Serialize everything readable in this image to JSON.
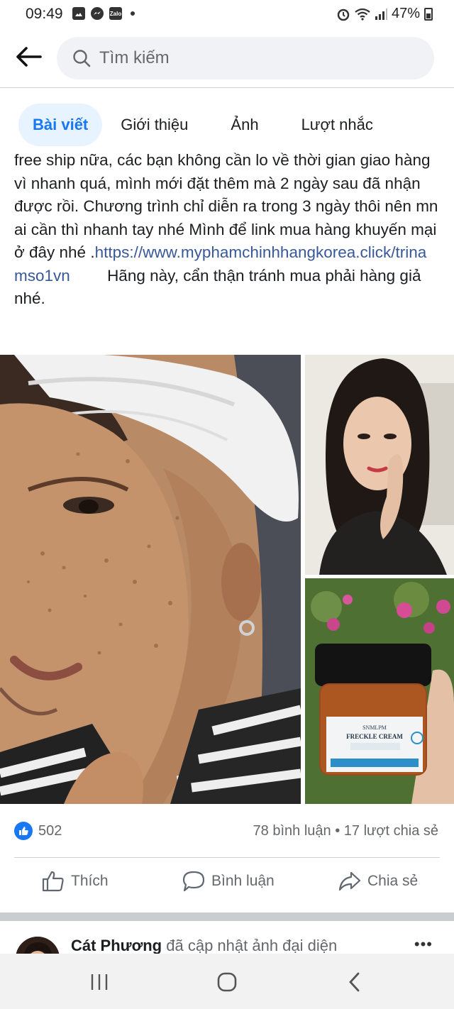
{
  "status_bar": {
    "time": "09:49",
    "battery": "47%",
    "app_icons": [
      "gallery-icon",
      "messenger-icon",
      "zalo-icon"
    ],
    "zalo_label": "Zalo"
  },
  "search": {
    "placeholder": "Tìm kiếm"
  },
  "tabs": [
    {
      "label": "Bài viết",
      "active": true
    },
    {
      "label": "Giới thiệu",
      "active": false
    },
    {
      "label": "Ảnh",
      "active": false
    },
    {
      "label": "Lượt nhắc",
      "active": false
    }
  ],
  "post": {
    "text_top_cut": "free ship nữa, các bạn không cần lo về thời gian",
    "text_main": "giao hàng vì nhanh quá, mình mới đặt thêm mà 2 ngày sau đã nhận được rồi. Chương trình chỉ diễn ra trong 3 ngày thôi nên mn ai cần thì nhanh tay nhé Mình để link mua hàng khuyến mại ở đây nhé .",
    "link": "https://www.myphamchinhhangkorea.click/trinamso1vn",
    "text_after": "Hãng này, cẩn thận tránh mua phải hàng giả nhé.",
    "product_label": {
      "brand": "SNMLPM",
      "name": "FRECKLE CREAM"
    }
  },
  "reactions": {
    "like_count": "502",
    "stats": "78 bình luận • 17 lượt chia sẻ"
  },
  "actions": {
    "like": "Thích",
    "comment": "Bình luận",
    "share": "Chia sẻ"
  },
  "next_post": {
    "name": "Cát Phương",
    "action": "đã cập nhật ảnh đại diện",
    "more": "•••"
  },
  "colors": {
    "accent": "#1877f2",
    "link": "#385898",
    "secondary_text": "#65676b"
  }
}
